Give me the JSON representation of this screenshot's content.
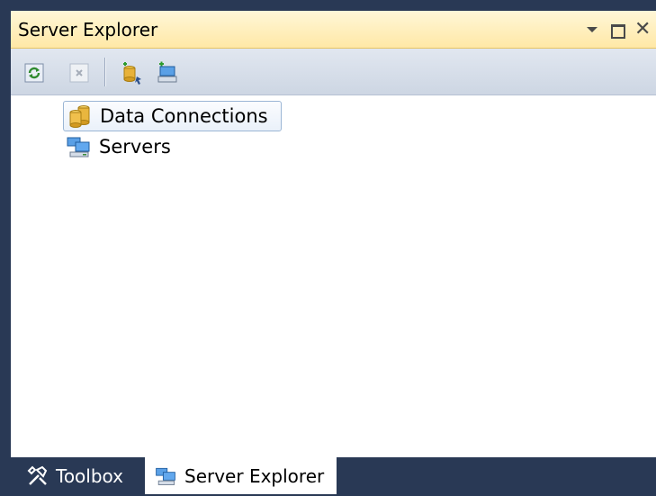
{
  "window": {
    "title": "Server Explorer",
    "controls": {
      "dropdown_icon": "dropdown-arrow-icon",
      "maximize_icon": "maximize-icon",
      "close_symbol": "✕"
    }
  },
  "toolbar": {
    "buttons": [
      {
        "name": "refresh",
        "icon": "refresh-icon"
      },
      {
        "name": "stop-refresh",
        "icon": "stop-refresh-icon",
        "disabled": true
      },
      {
        "name": "connect-to-database",
        "icon": "connect-database-icon"
      },
      {
        "name": "connect-to-server",
        "icon": "connect-server-icon"
      }
    ]
  },
  "tree": {
    "nodes": [
      {
        "label": "Data Connections",
        "icon": "database-icon",
        "selected": true,
        "expandable": false
      },
      {
        "label": "Servers",
        "icon": "servers-icon",
        "selected": false,
        "expandable": true
      }
    ]
  },
  "tabs": [
    {
      "label": "Toolbox",
      "icon": "toolbox-icon",
      "active": false
    },
    {
      "label": "Server Explorer",
      "icon": "server-explorer-icon",
      "active": true
    }
  ],
  "colors": {
    "frame_bg": "#293955",
    "title_gradient_top": "#fff7d8",
    "title_gradient_bottom": "#ffe8a6",
    "toolbar_bg": "#cdd6e3",
    "selection_border": "#9bb6d5"
  }
}
